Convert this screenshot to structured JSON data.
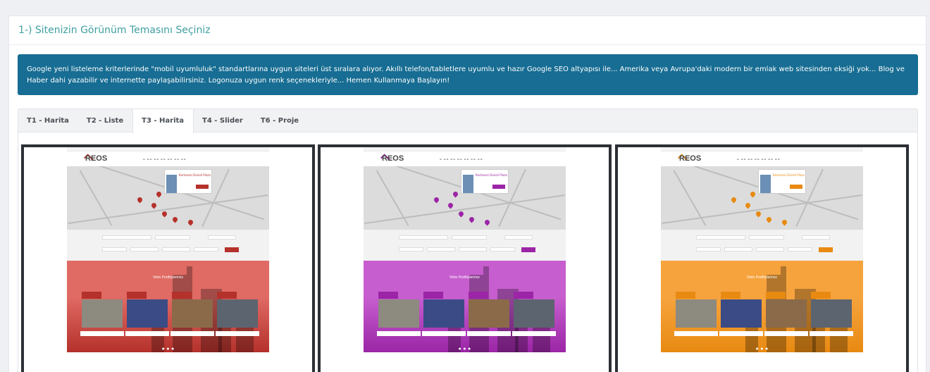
{
  "panel": {
    "title": "1-) Sitenizin Görünüm Temasını Seçiniz"
  },
  "notice": {
    "text": "Google yeni listeleme kriterlerinde \"mobil uyumluluk\" standartlarına uygun siteleri üst sıralara alıyor. Akıllı telefon/tabletlere uyumlu ve hazır Google SEO altyapısı ile... Amerika veya Avrupa'daki modern bir emlak web sitesinden eksiği yok... Blog ve Haber dahi yazabilir ve internette paylaşabilirsiniz. Logonuza uygun renk seçenekleriyle... Hemen Kullanmaya Başlayın!",
    "background": "#176d93"
  },
  "tabs": [
    {
      "label": "T1 - Harita",
      "active": false
    },
    {
      "label": "T2 - Liste",
      "active": false
    },
    {
      "label": "T3 - Harita",
      "active": true
    },
    {
      "label": "T4 - Slider",
      "active": false
    },
    {
      "label": "T6 - Proje",
      "active": false
    }
  ],
  "themes": [
    {
      "name": "theme-red",
      "accent": "#e06a64",
      "dark": "#b5312b"
    },
    {
      "name": "theme-purple",
      "accent": "#c75ecf",
      "dark": "#9b25a6"
    },
    {
      "name": "theme-orange",
      "accent": "#f6a33e",
      "dark": "#e88a12"
    }
  ],
  "preview": {
    "logo": "REOS",
    "popup_title": "Kartanesi Daireli Plaza",
    "band_text": "Vitrin Portföylerimiz"
  }
}
